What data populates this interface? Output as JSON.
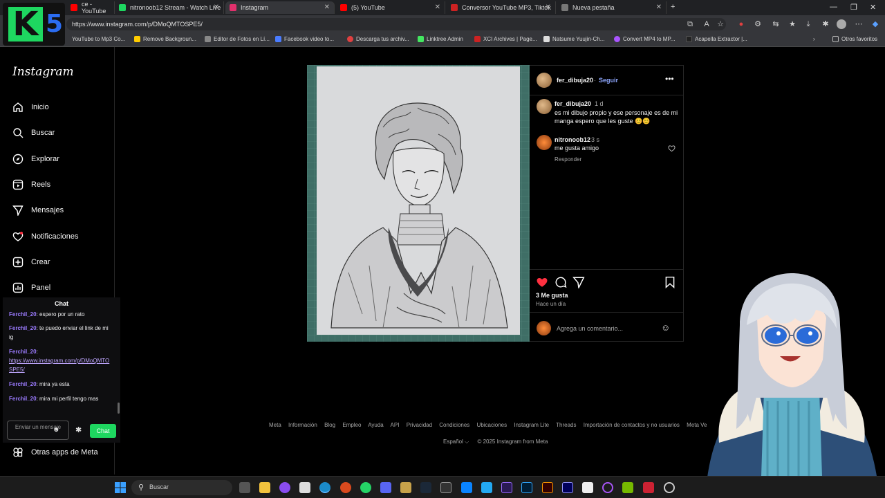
{
  "browser": {
    "tabs": [
      {
        "title": "ce - YouTube",
        "color": "#ff0000"
      },
      {
        "title": "nitronoob12 Stream - Watch Live",
        "color": "#1ed760"
      },
      {
        "title": "Instagram",
        "color": "#e1306c"
      },
      {
        "title": "(5) YouTube",
        "color": "#ff0000"
      },
      {
        "title": "Conversor YouTube MP3, Tiktok",
        "color": "#cc2222"
      },
      {
        "title": "Nueva pestaña",
        "color": "#cccccc"
      }
    ],
    "url": "https://www.instagram.com/p/DMoQMTOSPE5/",
    "bookmarks": [
      {
        "label": "YouTube to Mp3 Co...",
        "color": "#ff4444"
      },
      {
        "label": "Remove Backgroun...",
        "color": "#ffcc00"
      },
      {
        "label": "Editor de Fotos en Lí...",
        "color": "#888888"
      },
      {
        "label": "Facebook video to...",
        "color": "#4a7cff"
      },
      {
        "label": "Descarga tus archiv...",
        "color": "#e04040"
      },
      {
        "label": "Linktree Admin",
        "color": "#43e660"
      },
      {
        "label": "XCI Archives | Page...",
        "color": "#cc2222"
      },
      {
        "label": "Natsume Yuujin-Ch...",
        "color": "#dddddd"
      },
      {
        "label": "Convert MP4 to MP...",
        "color": "#aa55ff"
      },
      {
        "label": "Acapella Extractor |...",
        "color": "#222222"
      }
    ],
    "other_favorites": "Otros favoritos"
  },
  "logo_k5": {
    "k": "K",
    "five": "5"
  },
  "instagram": {
    "logo": "Instagram",
    "nav": [
      {
        "label": "Inicio",
        "icon": "home-icon"
      },
      {
        "label": "Buscar",
        "icon": "search-icon"
      },
      {
        "label": "Explorar",
        "icon": "compass-icon"
      },
      {
        "label": "Reels",
        "icon": "reels-icon"
      },
      {
        "label": "Mensajes",
        "icon": "messenger-icon"
      },
      {
        "label": "Notificaciones",
        "icon": "heart-icon"
      },
      {
        "label": "Crear",
        "icon": "plus-icon"
      },
      {
        "label": "Panel",
        "icon": "dashboard-icon"
      }
    ],
    "other_apps": "Otras apps de Meta"
  },
  "chat": {
    "title": "Chat",
    "messages": [
      {
        "user": "Ferchil_20",
        "text": "espero por un rato"
      },
      {
        "user": "Ferchil_20",
        "text": "te puedo enviar el link de mi ig"
      },
      {
        "user": "Ferchil_20",
        "text": "",
        "link": "https://www.instagram.com/p/DMoQMTOSPE5/"
      },
      {
        "user": "Ferchil_20",
        "text": "mira ya esta"
      },
      {
        "user": "Ferchil_20",
        "text": "mira mi perfil tengo mas"
      }
    ],
    "input_placeholder": "Enviar un mensaje",
    "send_label": "Chat"
  },
  "post": {
    "author": "fer_dibuja20",
    "follow": "Seguir",
    "caption_user": "fer_dibuja20",
    "caption_time": "1 d",
    "caption": "es mi dibujo propio y ese personaje es de mi manga espero que les guste 😊😊",
    "comment_user": "nitronoob12",
    "comment_time": "3 s",
    "comment_text": "me gusta amigo",
    "reply": "Responder",
    "likes": "3 Me gusta",
    "posted": "Hace un día",
    "add_comment": "Agrega un comentario..."
  },
  "footer": {
    "links": [
      "Meta",
      "Información",
      "Blog",
      "Empleo",
      "Ayuda",
      "API",
      "Privacidad",
      "Condiciones",
      "Ubicaciones",
      "Instagram Lite",
      "Threads",
      "Importación de contactos y no usuarios",
      "Meta Ve"
    ],
    "language": "Español",
    "copyright": "© 2025 Instagram from Meta"
  },
  "taskbar": {
    "search": "Buscar"
  },
  "colors": {
    "accent": "#1ed760",
    "ig_blue": "#0095f6",
    "like_red": "#ff3040"
  }
}
